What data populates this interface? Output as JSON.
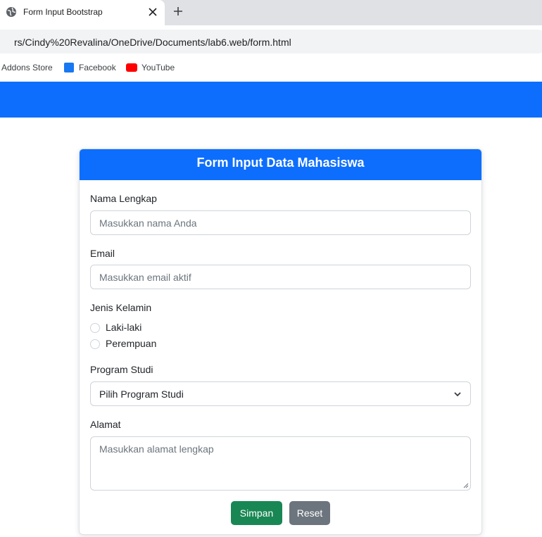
{
  "browser": {
    "tab_title": "Form Input Bootstrap",
    "url": "rs/Cindy%20Revalina/OneDrive/Documents/lab6.web/form.html",
    "bookmarks": [
      "Addons Store",
      "Facebook",
      "YouTube"
    ]
  },
  "form": {
    "title": "Form Input Data Mahasiswa",
    "nama_label": "Nama Lengkap",
    "nama_placeholder": "Masukkan nama Anda",
    "email_label": "Email",
    "email_placeholder": "Masukkan email aktif",
    "gender_label": "Jenis Kelamin",
    "gender_options": [
      "Laki-laki",
      "Perempuan"
    ],
    "prodi_label": "Program Studi",
    "prodi_selected": "Pilih Program Studi",
    "alamat_label": "Alamat",
    "alamat_placeholder": "Masukkan alamat lengkap",
    "save_button": "Simpan",
    "reset_button": "Reset"
  },
  "colors": {
    "primary": "#0d6efd",
    "success": "#198754",
    "secondary": "#6c757d"
  }
}
